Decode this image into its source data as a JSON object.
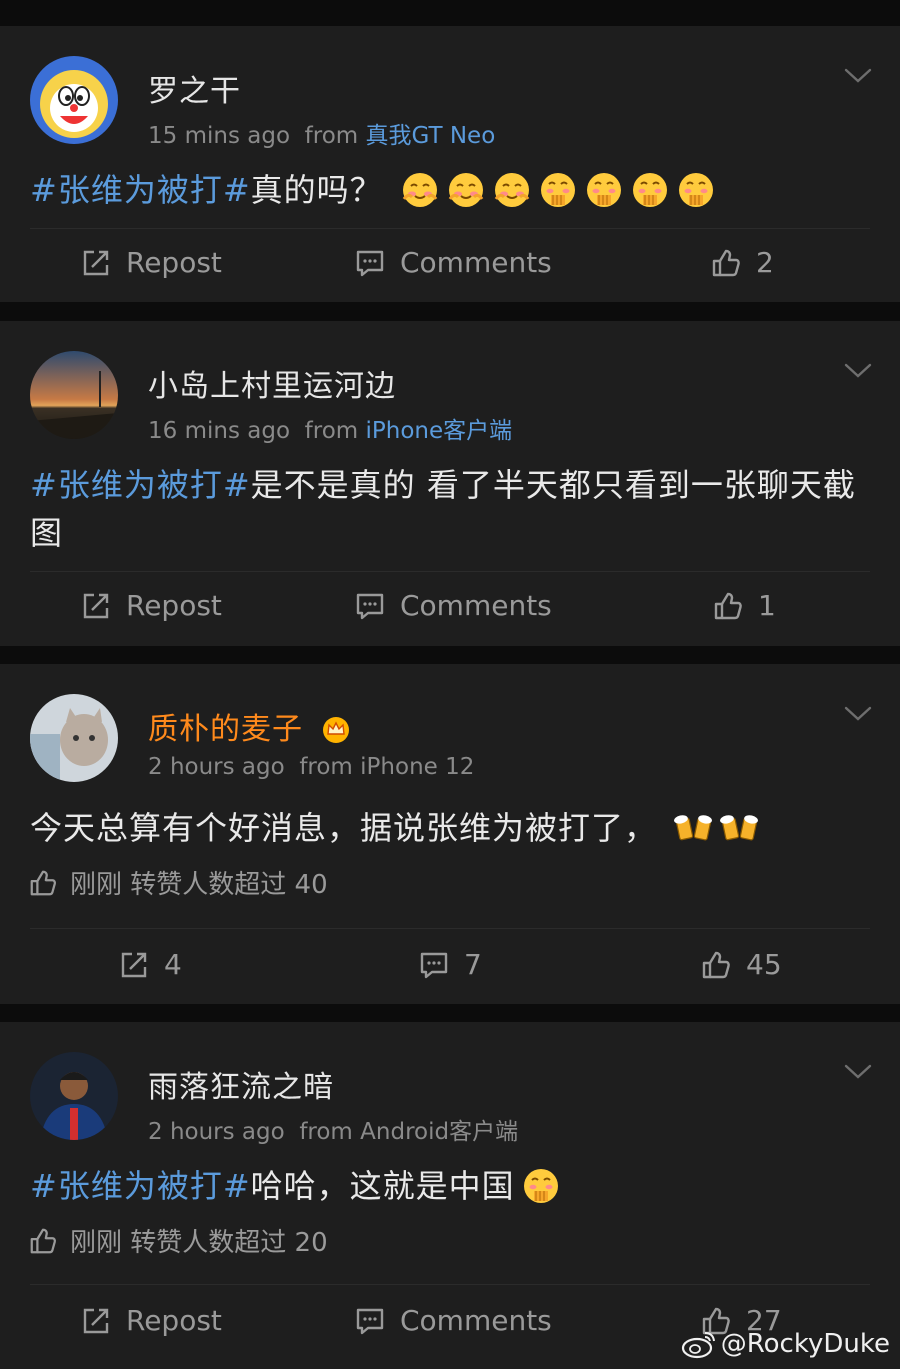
{
  "actions": {
    "repost": "Repost",
    "comments": "Comments"
  },
  "posts": [
    {
      "username": "罗之干",
      "time": "15 mins ago",
      "from_label": "from",
      "source": "真我GT Neo",
      "topic": "#张维为被打#",
      "text": "真的吗？",
      "emojis": [
        "blush-face",
        "blush-face",
        "blush-face",
        "giggle-face",
        "giggle-face",
        "giggle-face",
        "giggle-face"
      ],
      "likes": "2"
    },
    {
      "username": "小岛上村里运河边",
      "time": "16 mins ago",
      "from_label": "from",
      "source": "iPhone客户端",
      "topic": "#张维为被打#",
      "text": "是不是真的 看了半天都只看到一张聊天截图",
      "likes": "1"
    },
    {
      "username": "质朴的麦子",
      "time": "2 hours ago",
      "from_label": "from",
      "source": "iPhone 12",
      "text": "今天总算有个好消息，据说张维为被打了，",
      "emojis": [
        "beer-cheers",
        "beer-cheers"
      ],
      "like_hint": "刚刚 转赞人数超过 40",
      "reposts": "4",
      "comments": "7",
      "likes": "45"
    },
    {
      "username": "雨落狂流之暗",
      "time": "2 hours ago",
      "from_label": "from",
      "source": "Android客户端",
      "topic": "#张维为被打#",
      "text": "哈哈，这就是中国",
      "emojis": [
        "giggle-face"
      ],
      "like_hint": "刚刚 转赞人数超过 20",
      "likes": "27"
    }
  ],
  "watermark": "@RockyDuke",
  "colors": {
    "background": "#0c0c0c",
    "card": "#1e1e1e",
    "topic_link": "#5b9bdc",
    "vip_name": "#ff8a1c",
    "muted": "#8a8a8a"
  }
}
